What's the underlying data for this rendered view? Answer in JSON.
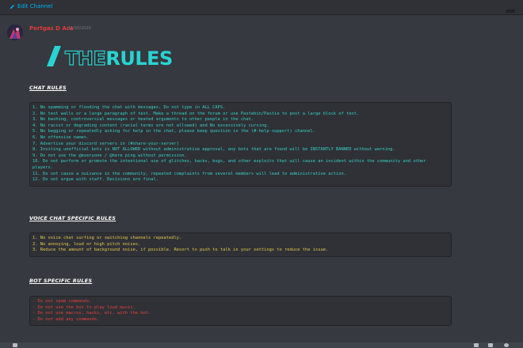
{
  "header": {
    "edit_label": "Edit Channel"
  },
  "message": {
    "author": "Portgas D Ace",
    "timestamp": "11/30/2020",
    "logo": {
      "prefix": "/",
      "the": "THE",
      "rules": "RULES"
    }
  },
  "sections": {
    "chat": {
      "title": "CHAT RULES",
      "lines": [
        "1. No spamming or flooding the chat with messages. Do not type in ALL CAPS.",
        "2. No text walls or a large paragraph of text. Make a thread on the forum or use Pastebin/Pastie to post a large block of text.",
        "3. No bashing, controversial messages or heated arguments to other people in the chat.",
        "4. No racist or degrading content (racial terms are not allowed) and No excessively cursing.",
        "5. No begging or repeatedly asking for help in the chat, please keep question in the (#-help-support) channel.",
        "6. No offensive names.",
        "7. Advertise your discord servers in (#share-your-server)",
        "8. Inviting unofficial bots is NOT ALLOWED without administrative approval, any bots that are found will be INSTANTLY BANNED without warning.",
        "9. Do not use the @everyone / @here ping without permission.",
        "10. Do not perform or promote the intentional use of glitches, hacks, bugs, and other exploits that will cause an incident within the community and other players.",
        "11. Do not cause a nuisance in the community, repeated complaints from several members will lead to administrative action.",
        "12. Do not argue with staff. Decisions are final."
      ]
    },
    "voice": {
      "title": "VOICE CHAT SPECIFIC RULES",
      "lines": [
        "1. No voice chat surfing or switching channels repeatedly.",
        "2. No annoying, loud or high pitch noises.",
        "3. Reduce the amount of background noise, if possible. Resort to push to talk in your settings to reduce the issue."
      ]
    },
    "bot": {
      "title": "BOT SPECIFIC RULES",
      "lines": [
        "- Do not spam commands.",
        "- Do not use the bot to play loud music.",
        "- Do not use macros, hacks, etc. with the bot.",
        "- Do not add any commands."
      ]
    }
  },
  "colors": {
    "accent_link": "#00b0f4",
    "author": "#e03c3c",
    "chat_text": "#35d0c5",
    "voice_text": "#e6c84a",
    "bot_text": "#e8403c",
    "background": "#36393f"
  },
  "icons": [
    "pencil-icon",
    "avatar",
    "gift-icon",
    "gif-icon",
    "emoji-icon"
  ]
}
